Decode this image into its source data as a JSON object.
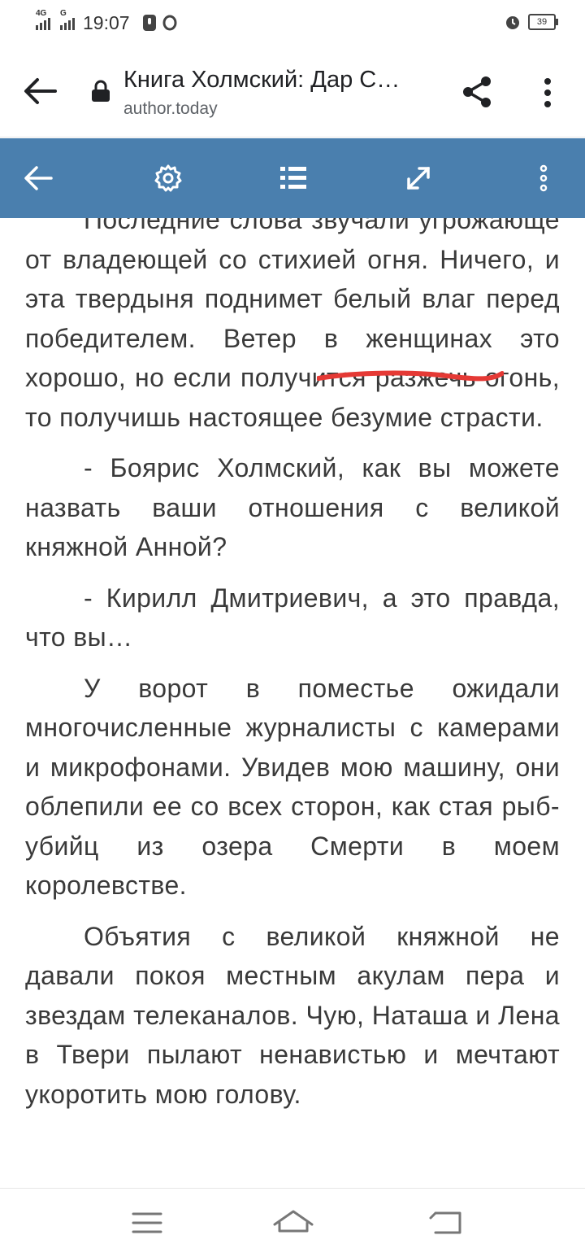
{
  "status_bar": {
    "network1": "4G",
    "network2": "G",
    "time": "19:07",
    "battery_level": "39"
  },
  "browser": {
    "page_title": "Книга Холмский: Дар С…",
    "domain": "author.today"
  },
  "reader_toolbar": {
    "icons": [
      "arrow-left-icon",
      "gear-icon",
      "contents-list-icon",
      "expand-icon",
      "more-vertical-icon"
    ],
    "background": "#4a7fae"
  },
  "reader": {
    "paragraphs": [
      "Последние слова звучали угрожающе от владеющей со стихией огня. Ничего, и эта твердыня поднимет белый влаг перед победителем. Ветер в женщинах это хорошо, но если получится разжечь огонь, то получишь настоящее безумие страсти.",
      "- Бояриᴄ Холмский, как вы можете назвать ваши отношения с великой княжной Анной?",
      "- Кирилл Дмитриевич, а это правда, что вы…",
      "У ворот в поместье ожидали многочисленные журналисты с камерами и микрофонами. Увидев мою машину, они облепили ее со всех сторон, как стая рыб-убийц из озера Смерти в моем королевстве.",
      "Объятия с великой княжной не давали покоя местным акулам пера и звездам телеканалов. Чую, Наташа и Лена в Твери пылают ненавистью и мечтают укоротить мою голову."
    ],
    "highlight_color": "#e53935"
  },
  "nav_bar": {
    "icons": [
      "menu-icon",
      "home-icon",
      "back-icon"
    ]
  }
}
